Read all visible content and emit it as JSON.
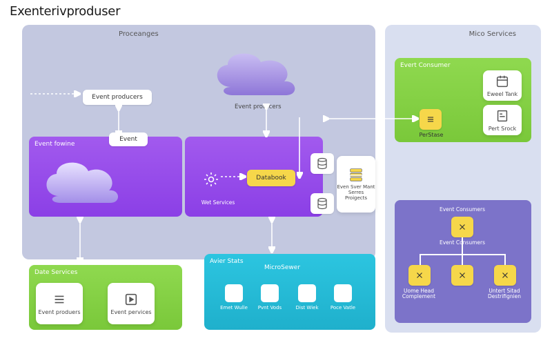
{
  "title": "Exenterivproduser",
  "panels": {
    "proceanges": {
      "title": "Proceanges"
    },
    "micro": {
      "title": "Mico Services"
    }
  },
  "boxes": {
    "event_fowine": {
      "title": "Event fowine"
    },
    "web_services": {
      "title": "Wet Services",
      "databook": "Databook"
    },
    "date_services": {
      "title": "Date Services"
    },
    "avier_stats": {
      "title": "Avier Stats",
      "microsewer": "MicroSewer"
    },
    "event_consumer": {
      "title": "Evert Consumer"
    },
    "event_consumers": {
      "title": "Event Consumers",
      "sub": "Event Consumers"
    }
  },
  "pills": {
    "event_producers": "Event producers",
    "event": "Event"
  },
  "clouds": {
    "producers_label": "Event protucers"
  },
  "cards": {
    "event_products": "Event produers",
    "event_pervices": "Event pervices",
    "eweel_tank": "Eweel Tank",
    "pert_srock": "Pert Srock",
    "perstase": "PerStase",
    "server_caption": "Even Sver Mant Serres Proigects"
  },
  "consumers": {
    "uome_head": "Uome Head Complement",
    "untert_sitad": "Untert Sitad Destrifignien"
  },
  "micro_items": [
    "Emet Wulle",
    "Pvnt Vods",
    "Dist Wiek",
    "Poce Vatle"
  ]
}
